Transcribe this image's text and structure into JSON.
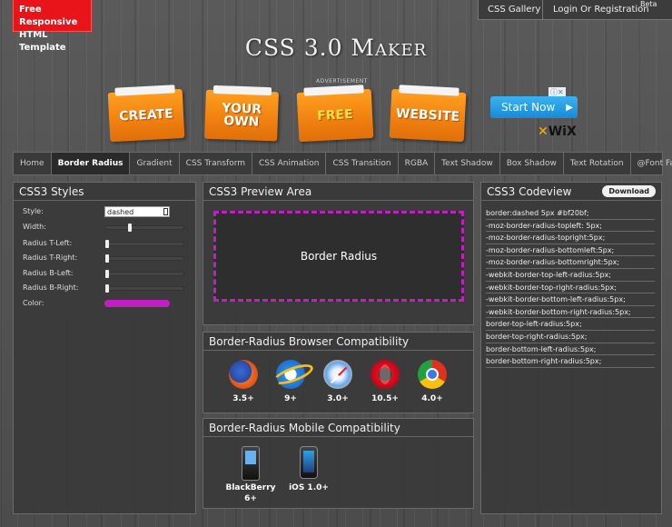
{
  "promo": {
    "line1": "Free Responsive",
    "line2": "HTML Template"
  },
  "topnav": {
    "gallery": "CSS Gallery",
    "login": "Login Or Registration",
    "beta": "Beta"
  },
  "site_title": "CSS 3.0 Maker",
  "ad": {
    "label": "ADVERTISEMENT",
    "folders": [
      "CREATE",
      "YOUR OWN",
      "FREE",
      "WEBSITE"
    ],
    "start_now": "Start Now",
    "wix_logo_prefix": "",
    "wix_logo": "WiX"
  },
  "tabs": [
    "Home",
    "Border Radius",
    "Gradient",
    "CSS Transform",
    "CSS Animation",
    "CSS Transition",
    "RGBA",
    "Text Shadow",
    "Box Shadow",
    "Text Rotation",
    "@Font Face"
  ],
  "active_tab": "Border Radius",
  "styles_panel": {
    "title": "CSS3 Styles",
    "controls": [
      {
        "label": "Style:",
        "type": "select",
        "value": "dashed"
      },
      {
        "label": "Width:",
        "type": "slider",
        "value": 0.3
      },
      {
        "label": "Radius T-Left:",
        "type": "slider",
        "value": 0
      },
      {
        "label": "Radius T-Right:",
        "type": "slider",
        "value": 0
      },
      {
        "label": "Radius B-Left:",
        "type": "slider",
        "value": 0
      },
      {
        "label": "Radius B-Right:",
        "type": "slider",
        "value": 0
      },
      {
        "label": "Color:",
        "type": "color",
        "value": "#bf20bf"
      }
    ]
  },
  "preview_panel": {
    "title": "CSS3 Preview Area",
    "box_text": "Border Radius",
    "border_color": "#bf20bf"
  },
  "browser_panel": {
    "title": "Border-Radius Browser Compatibility",
    "browsers": [
      {
        "icon": "firefox-icon",
        "version": "3.5+"
      },
      {
        "icon": "ie-icon",
        "version": "9+"
      },
      {
        "icon": "safari-icon",
        "version": "3.0+"
      },
      {
        "icon": "opera-icon",
        "version": "10.5+"
      },
      {
        "icon": "chrome-icon",
        "version": "4.0+"
      }
    ]
  },
  "mobile_panel": {
    "title": "Border-Radius Mobile Compatibility",
    "devices": [
      {
        "icon": "blackberry-icon",
        "line1": "BlackBerry",
        "line2": "6+"
      },
      {
        "icon": "iphone-icon",
        "line1": "iOS 1.0+",
        "line2": ""
      }
    ]
  },
  "code_panel": {
    "title": "CSS3 Codeview",
    "download": "Download",
    "lines": [
      "border:dashed 5px #bf20bf;",
      "-moz-border-radius-topleft: 5px;",
      "-moz-border-radius-topright:5px;",
      "-moz-border-radius-bottomleft:5px;",
      "-moz-border-radius-bottomright:5px;",
      "-webkit-border-top-left-radius:5px;",
      "-webkit-border-top-right-radius:5px;",
      "-webkit-border-bottom-left-radius:5px;",
      "-webkit-border-bottom-right-radius:5px;",
      "border-top-left-radius:5px;",
      "border-top-right-radius:5px;",
      "border-bottom-left-radius:5px;",
      "border-bottom-right-radius:5px;"
    ]
  }
}
